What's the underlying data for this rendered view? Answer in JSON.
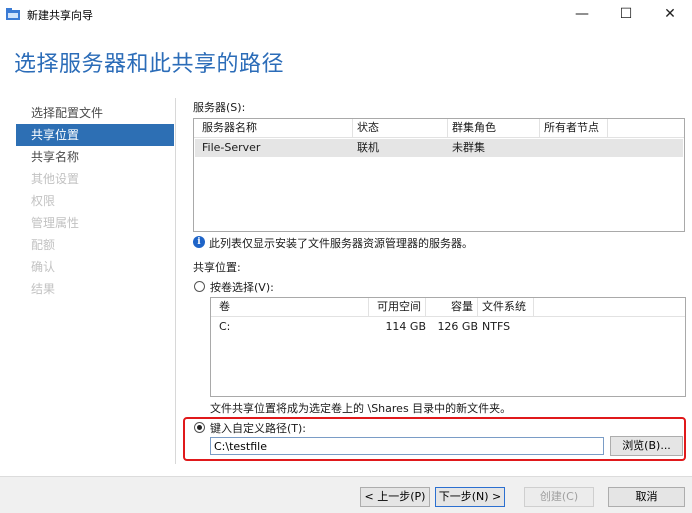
{
  "window": {
    "title": "新建共享向导",
    "minimize_glyph": "—",
    "maximize_glyph": "☐",
    "close_glyph": "✕",
    "app_icon": "share-folder-icon"
  },
  "page_heading": "选择服务器和此共享的路径",
  "nav": {
    "items": [
      {
        "label": "选择配置文件",
        "state": "normal"
      },
      {
        "label": "共享位置",
        "state": "active"
      },
      {
        "label": "共享名称",
        "state": "normal"
      },
      {
        "label": "其他设置",
        "state": "disabled"
      },
      {
        "label": "权限",
        "state": "disabled"
      },
      {
        "label": "管理属性",
        "state": "disabled"
      },
      {
        "label": "配额",
        "state": "disabled"
      },
      {
        "label": "确认",
        "state": "disabled"
      },
      {
        "label": "结果",
        "state": "disabled"
      }
    ]
  },
  "servers": {
    "label": "服务器(S):",
    "columns": [
      "服务器名称",
      "状态",
      "群集角色",
      "所有者节点"
    ],
    "rows": [
      [
        "File-Server",
        "联机",
        "未群集",
        ""
      ]
    ],
    "info_text": "此列表仅显示安装了文件服务器资源管理器的服务器。"
  },
  "share_location": {
    "label": "共享位置:",
    "by_volume_label": "按卷选择(V):",
    "volume_columns": [
      "卷",
      "可用空间",
      "容量",
      "文件系统"
    ],
    "volume_rows": [
      [
        "C:",
        "114 GB",
        "126 GB",
        "NTFS"
      ]
    ],
    "note": "文件共享位置将成为选定卷上的 \\Shares 目录中的新文件夹。",
    "custom_path_label": "键入自定义路径(T):",
    "custom_path_value": "C:\\testfile",
    "browse_label": "浏览(B)...",
    "selected_option": "custom_path"
  },
  "footer": {
    "prev_label": "< 上一步(P)",
    "next_label": "下一步(N) >",
    "create_label": "创建(C)",
    "cancel_label": "取消"
  },
  "colors": {
    "heading": "#2b6cb8",
    "nav_active": "#2d6fb4",
    "highlight": "#e0191b",
    "info": "#1e64c8"
  }
}
